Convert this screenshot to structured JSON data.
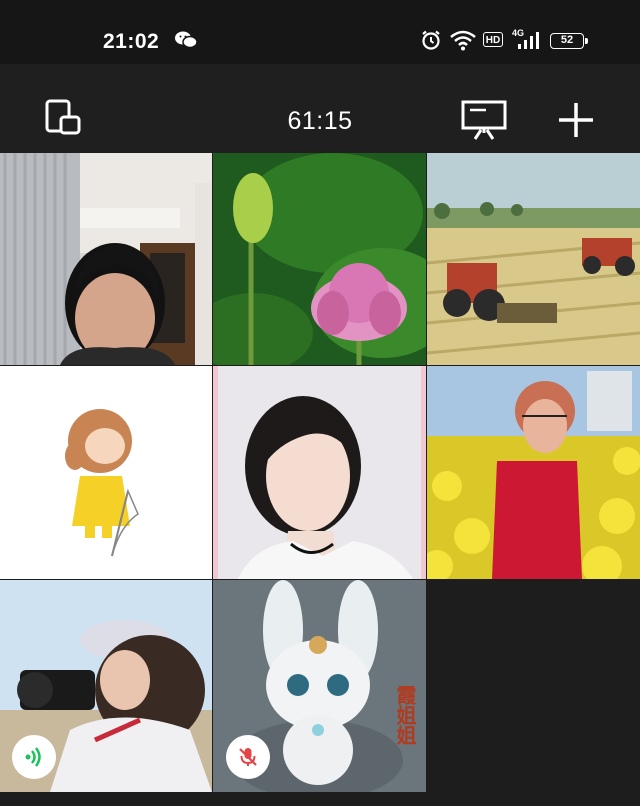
{
  "status_bar": {
    "time": "21:02",
    "battery": "52",
    "hd_label": "HD",
    "network": "4G",
    "icons": [
      "wechat-icon",
      "alarm-icon",
      "wifi-icon",
      "signal-icon",
      "battery-icon"
    ]
  },
  "toolbar": {
    "timer": "61:15",
    "left_icon": "switch-window-icon",
    "right_icons": [
      "screen-share-icon",
      "add-icon"
    ]
  },
  "participants": [
    {
      "name": "participant-1",
      "muted": false,
      "speaking": false
    },
    {
      "name": "participant-2",
      "muted": false,
      "speaking": false
    },
    {
      "name": "participant-3",
      "muted": false,
      "speaking": false
    },
    {
      "name": "participant-4",
      "muted": false,
      "speaking": false
    },
    {
      "name": "participant-5",
      "muted": false,
      "speaking": false
    },
    {
      "name": "participant-6",
      "muted": false,
      "speaking": false
    },
    {
      "name": "participant-7",
      "muted": false,
      "speaking": true
    },
    {
      "name": "participant-8",
      "muted": true,
      "speaking": false
    }
  ],
  "avatar_text": "霞姐姐",
  "colors": {
    "background": "#1d1d1d",
    "status_bar": "#161616",
    "speaking_badge": "#19c35a",
    "muted_badge": "#e54545"
  }
}
